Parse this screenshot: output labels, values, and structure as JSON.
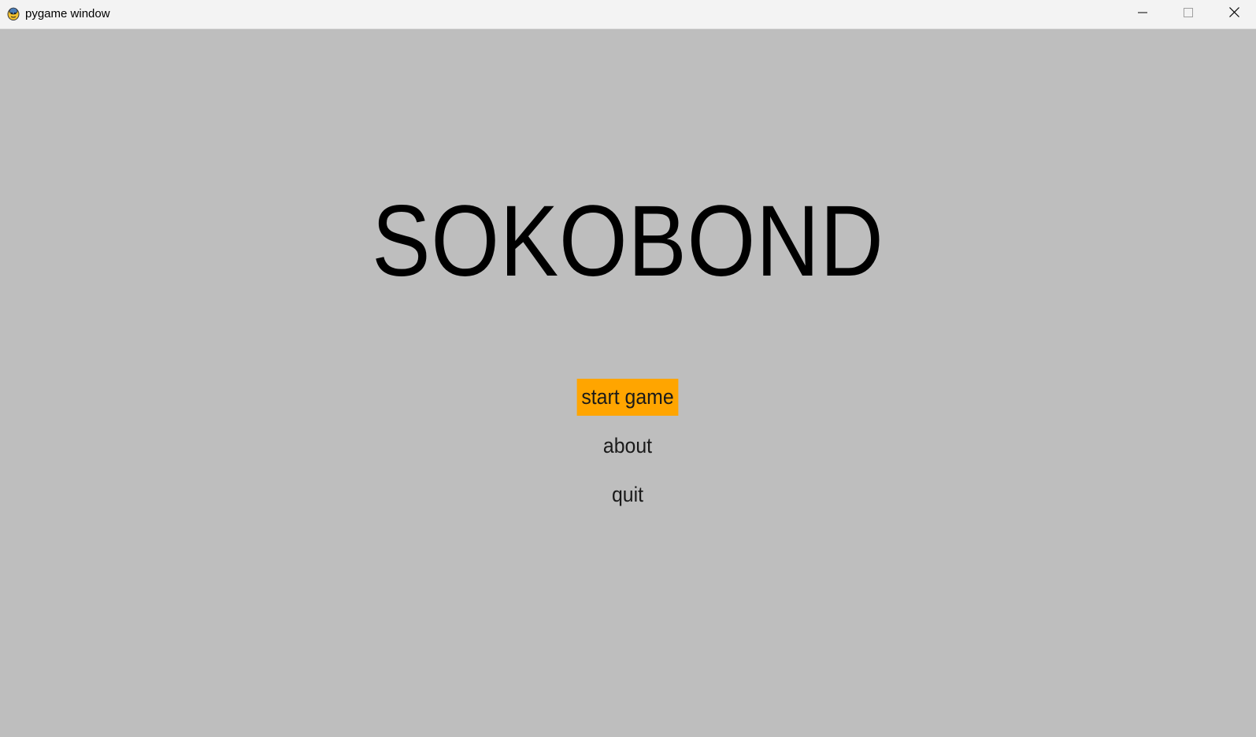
{
  "window": {
    "title": "pygame window",
    "icon": "pygame-snake-icon",
    "controls": {
      "minimize_icon": "minimize-icon",
      "maximize_icon": "maximize-icon",
      "close_icon": "close-icon"
    }
  },
  "game": {
    "title": "SOKOBOND",
    "background_color": "#bebebe",
    "menu": [
      {
        "label": "start game",
        "selected": true,
        "highlight_color": "#ffa500"
      },
      {
        "label": "about",
        "selected": false
      },
      {
        "label": "quit",
        "selected": false
      }
    ]
  }
}
